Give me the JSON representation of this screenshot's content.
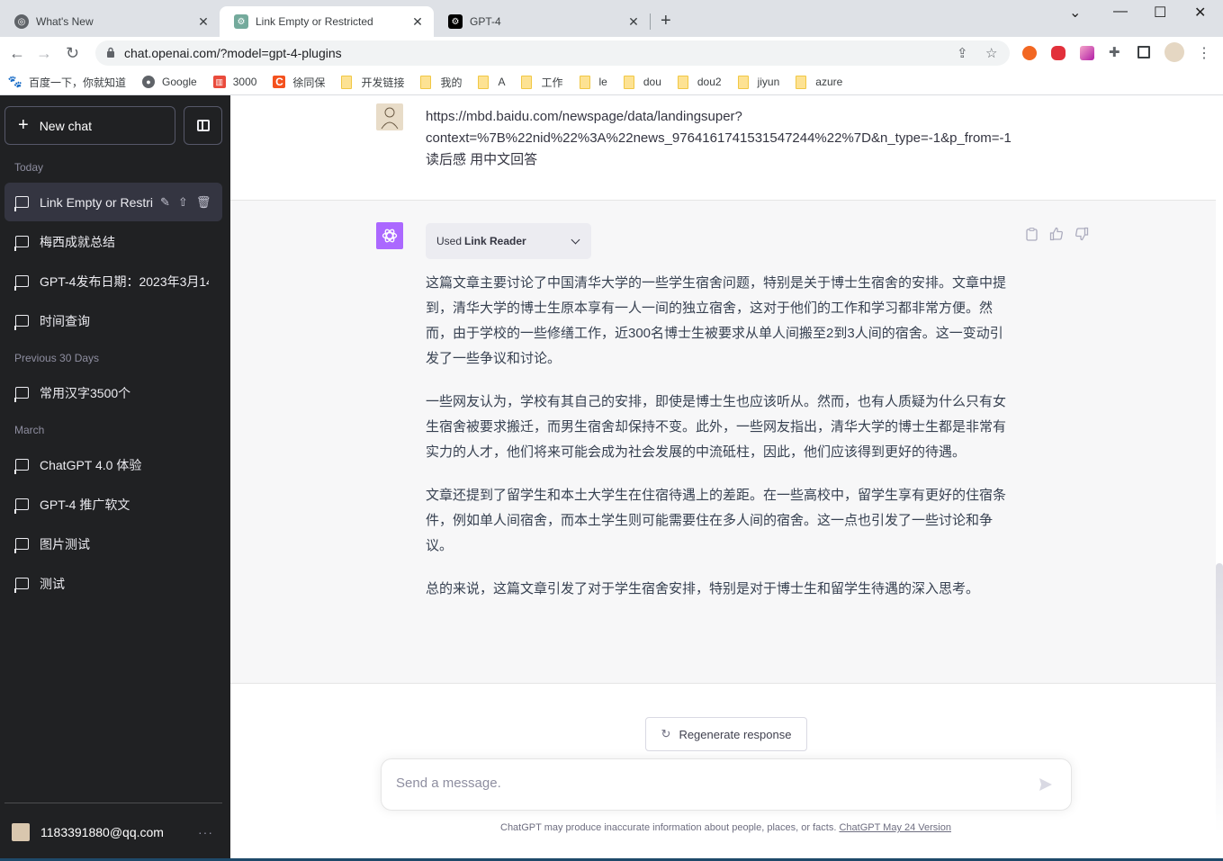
{
  "browser": {
    "tabs": [
      {
        "title": "What's New",
        "icon": "chrome-icon",
        "active": false
      },
      {
        "title": "Link Empty or Restricted",
        "icon": "openai-icon",
        "active": true
      },
      {
        "title": "GPT-4",
        "icon": "openai-icon",
        "active": false
      }
    ],
    "url": "chat.openai.com/?model=gpt-4-plugins",
    "bookmarks": [
      {
        "label": "百度一下，你就知道",
        "icon": "baidu-icon"
      },
      {
        "label": "Google",
        "icon": "globe-icon"
      },
      {
        "label": "3000",
        "icon": "book-icon"
      },
      {
        "label": "徐同保",
        "icon": "c-icon"
      },
      {
        "label": "开发链接",
        "icon": "folder-icon"
      },
      {
        "label": "我的",
        "icon": "folder-icon"
      },
      {
        "label": "A",
        "icon": "folder-icon"
      },
      {
        "label": "工作",
        "icon": "folder-icon"
      },
      {
        "label": "le",
        "icon": "folder-icon"
      },
      {
        "label": "dou",
        "icon": "folder-icon"
      },
      {
        "label": "dou2",
        "icon": "folder-icon"
      },
      {
        "label": "jiyun",
        "icon": "folder-icon"
      },
      {
        "label": "azure",
        "icon": "folder-icon"
      }
    ]
  },
  "sidebar": {
    "new_chat": "New chat",
    "groups": [
      {
        "label": "Today",
        "items": [
          "Link Empty or Restri",
          "梅西成就总结",
          "GPT-4发布日期：2023年3月14",
          "时间查询"
        ]
      },
      {
        "label": "Previous 30 Days",
        "items": [
          "常用汉字3500个"
        ]
      },
      {
        "label": "March",
        "items": [
          "ChatGPT 4.0 体验",
          "GPT-4 推广软文",
          "图片测试",
          "测试"
        ]
      }
    ],
    "user_email": "1183391880@qq.com",
    "more": "···"
  },
  "conversation": {
    "user_message": "https://mbd.baidu.com/newspage/data/landingsuper?context=%7B%22nid%22%3A%22news_9764161741531547244%22%7D&n_type=-1&p_from=-1 读后感 用中文回答",
    "user_message_lines": [
      "https://mbd.baidu.com/newspage/data/landingsuper?",
      "context=%7B%22nid%22%3A%22news_9764161741531547244%22%7D&n_type=-1&p_from=-1",
      "读后感 用中文回答"
    ],
    "plugin_used_prefix": "Used",
    "plugin_used_name": "Link Reader",
    "assistant_paragraphs": [
      "这篇文章主要讨论了中国清华大学的一些学生宿舍问题，特别是关于博士生宿舍的安排。文章中提到，清华大学的博士生原本享有一人一间的独立宿舍，这对于他们的工作和学习都非常方便。然而，由于学校的一些修缮工作，近300名博士生被要求从单人间搬至2到3人间的宿舍。这一变动引发了一些争议和讨论。",
      "一些网友认为，学校有其自己的安排，即使是博士生也应该听从。然而，也有人质疑为什么只有女生宿舍被要求搬迁，而男生宿舍却保持不变。此外，一些网友指出，清华大学的博士生都是非常有实力的人才，他们将来可能会成为社会发展的中流砥柱，因此，他们应该得到更好的待遇。",
      "文章还提到了留学生和本土大学生在住宿待遇上的差距。在一些高校中，留学生享有更好的住宿条件，例如单人间宿舍，而本土学生则可能需要住在多人间的宿舍。这一点也引发了一些讨论和争议。",
      "总的来说，这篇文章引发了对于学生宿舍安排，特别是对于博士生和留学生待遇的深入思考。"
    ]
  },
  "composer": {
    "regenerate": "Regenerate response",
    "placeholder": "Send a message.",
    "disclaimer": "ChatGPT may produce inaccurate information about people, places, or facts.",
    "version_link": "ChatGPT May 24 Version"
  },
  "colors": {
    "sidebar_bg": "#202123",
    "assistant_avatar": "#ab68ff",
    "assistant_bg": "#f7f7f8"
  }
}
